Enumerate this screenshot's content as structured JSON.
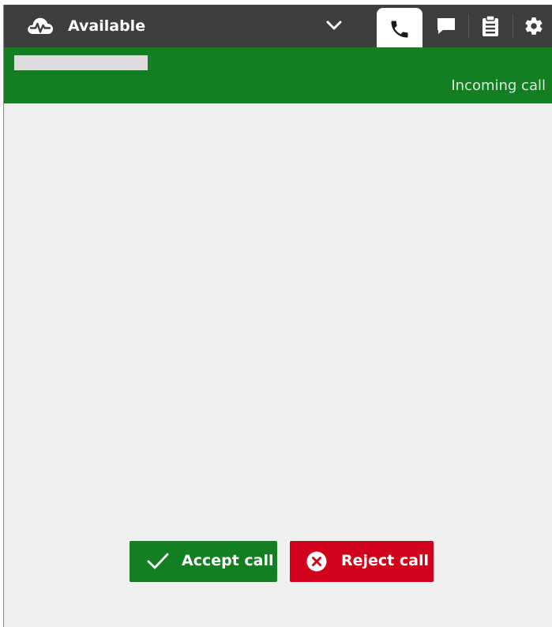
{
  "status": {
    "label": "Available",
    "icon": "cloud-pulse-icon",
    "dropdown_icon": "chevron-down-icon"
  },
  "tabs": [
    {
      "name": "phone",
      "icon": "phone-icon",
      "active": true
    },
    {
      "name": "chat",
      "icon": "chat-bubble-icon",
      "active": false
    },
    {
      "name": "tasks",
      "icon": "clipboard-icon",
      "active": false
    },
    {
      "name": "settings",
      "icon": "gear-icon",
      "active": false
    }
  ],
  "call": {
    "state_label": "Incoming call"
  },
  "actions": {
    "accept_label": "Accept call",
    "reject_label": "Reject call"
  },
  "colors": {
    "topbar": "#3e3e3e",
    "header_green": "#137f22",
    "accept": "#137f22",
    "reject": "#d0021b",
    "content_bg": "#f0f0f0"
  }
}
